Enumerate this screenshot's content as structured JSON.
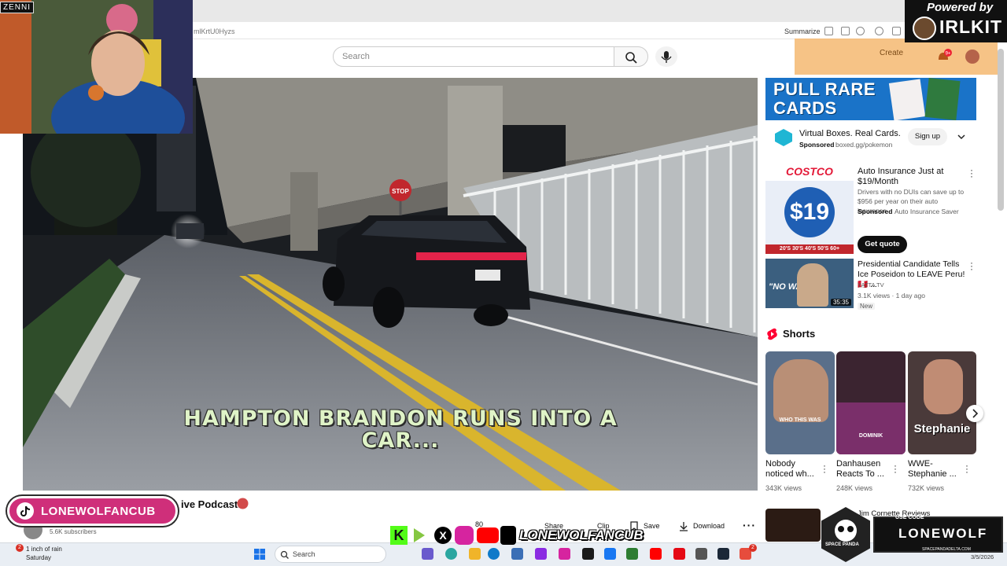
{
  "browser": {
    "url": "mlKrtU0Hyzs",
    "summarize_label": "Summarize"
  },
  "youtube_header": {
    "search_placeholder": "Search",
    "create_label": "Create",
    "notifications_count": "9+"
  },
  "video": {
    "overlay_title": "HAMPTON BRANDON RUNS INTO A CAR...",
    "title_fragment": "ive Podcast!",
    "channel_subscribers": "5.6K subscribers",
    "like_count": "80",
    "actions": [
      "Share",
      "Clip",
      "Save",
      "Download"
    ]
  },
  "webcam": {
    "sponsor_label": "ZENNI"
  },
  "powered": {
    "label": "Powered by",
    "brand": "IRLKIT"
  },
  "sidebar": {
    "ad_banner": {
      "headline": "PULL RARE CARDS",
      "title": "Virtual Boxes. Real Cards.",
      "sponsored": "Sponsored",
      "domain": "boxed.gg/pokemon",
      "cta": "Sign up"
    },
    "costco_ad": {
      "thumb_brand": "COSTCO",
      "thumb_price": "$19",
      "thumb_ages": "20'S 30'S 40'S 50'S 60+",
      "title": "Auto Insurance Just at $19/Month",
      "description": "Drivers with no DUIs can save up to $956 per year on their auto insurance",
      "sponsored": "Sponsored",
      "advertiser": "Auto Insurance Saver",
      "cta": "Get quote"
    },
    "video_item": {
      "title": "Presidential Candidate Tells Ice Poseidon to LEAVE Peru! 🇵🇪 ...",
      "channel": "YATTA TV",
      "meta": "3.1K views · 1 day ago",
      "badge": "New",
      "duration": "35:35",
      "thumb_text": "\"NO WAY\""
    },
    "shorts_heading": "Shorts",
    "shorts": [
      {
        "title": "Nobody noticed wh...",
        "views": "343K views",
        "thumb_text": "WHO THIS WAS"
      },
      {
        "title": "Danhausen Reacts To ...",
        "views": "248K views",
        "thumb_text": "DOMINIK"
      },
      {
        "title": "WWE- Stephanie ...",
        "views": "732K views",
        "thumb_text": "Stephanie"
      }
    ],
    "next_item_title": "Jim Cornette Reviews"
  },
  "overlays": {
    "tiktok_badge": "LONEWOLFANCUB",
    "socials_name": "LONEWOLFANCUB",
    "lonewolf_name": "LONEWOLF",
    "lonewolf_code": "USE CODE",
    "lonewolf_url": "SPACEPANDADELTA.COM",
    "panda_label": "SPACE PANDA"
  },
  "taskbar": {
    "weather_title": "1 inch of rain",
    "weather_day": "Saturday",
    "weather_badge": "2",
    "search_label": "Search",
    "date": "3/5/2026",
    "tray_badge": "2"
  },
  "colors": {
    "accent_red": "#ff0033",
    "tiktok_pink": "#cf2f7a",
    "ad_blue": "#1a73c8"
  }
}
